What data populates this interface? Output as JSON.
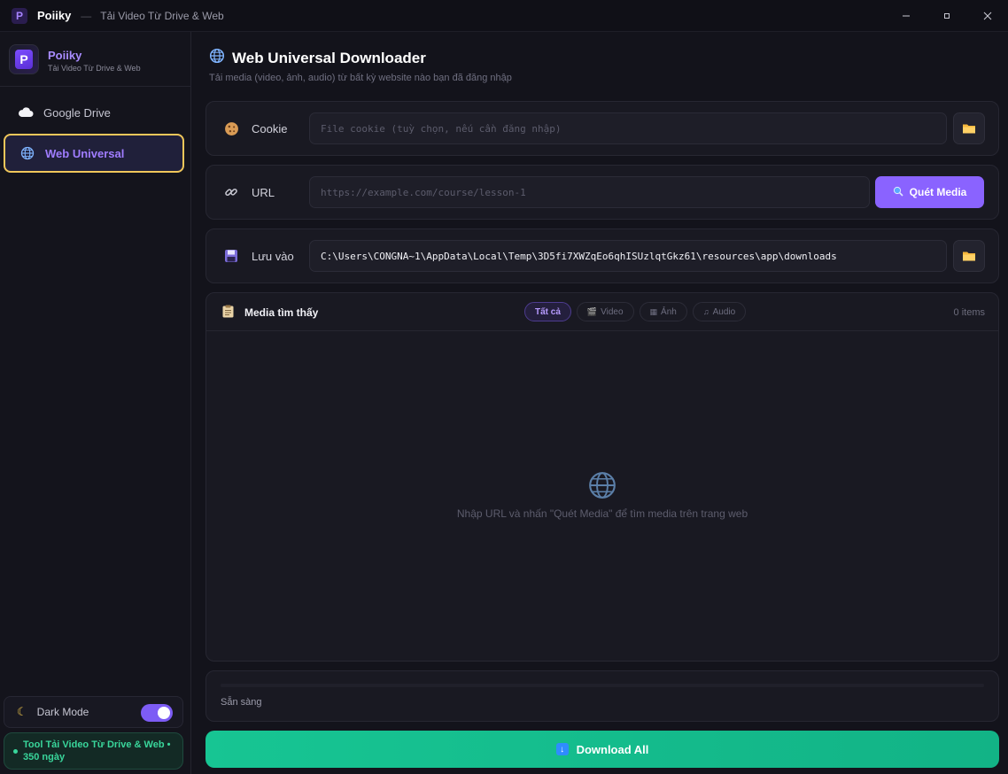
{
  "titlebar": {
    "app_name": "Poiiky",
    "separator": "—",
    "subtitle": "Tải Video Từ Drive & Web",
    "minimize": "—",
    "maximize": "▫",
    "close": "✕"
  },
  "sidebar": {
    "brand_name": "Poiiky",
    "brand_tagline": "Tải Video Từ Drive & Web",
    "logo_letter": "P",
    "items": [
      {
        "label": "Google Drive",
        "icon": "cloud-icon",
        "active": false
      },
      {
        "label": "Web Universal",
        "icon": "globe-icon",
        "active": true
      }
    ],
    "dark_mode_label": "Dark Mode",
    "dark_mode_on": true,
    "license_text": "Tool Tải Video Từ Drive & Web • 350 ngày"
  },
  "main": {
    "title": "Web Universal Downloader",
    "description": "Tải media (video, ảnh, audio) từ bất kỳ website nào bạn đã đăng nhập",
    "cookie": {
      "label": "Cookie",
      "placeholder": "File cookie (tuỳ chọn, nếu cần đăng nhập)",
      "value": ""
    },
    "url": {
      "label": "URL",
      "placeholder": "https://example.com/course/lesson-1",
      "value": "",
      "scan_button": "Quét Media"
    },
    "save": {
      "label": "Lưu vào",
      "value": "C:\\Users\\CONGNA~1\\AppData\\Local\\Temp\\3D5fi7XWZqEo6qhISUzlqtGkz61\\resources\\app\\downloads"
    },
    "media": {
      "title": "Media tìm thấy",
      "filters": [
        {
          "label": "Tất cả",
          "icon": "",
          "active": true
        },
        {
          "label": "Video",
          "icon": "🎬",
          "active": false
        },
        {
          "label": "Ảnh",
          "icon": "▦",
          "active": false
        },
        {
          "label": "Audio",
          "icon": "♫",
          "active": false
        }
      ],
      "count": "0 items",
      "empty_text": "Nhập URL và nhấn \"Quét Media\" để tìm media trên trang web"
    },
    "status_text": "Sẵn sàng",
    "download_all": "Download All"
  },
  "colors": {
    "accent": "#8a63ff",
    "active_border": "#f0c75a",
    "success": "#17c593",
    "background": "#13131b"
  }
}
